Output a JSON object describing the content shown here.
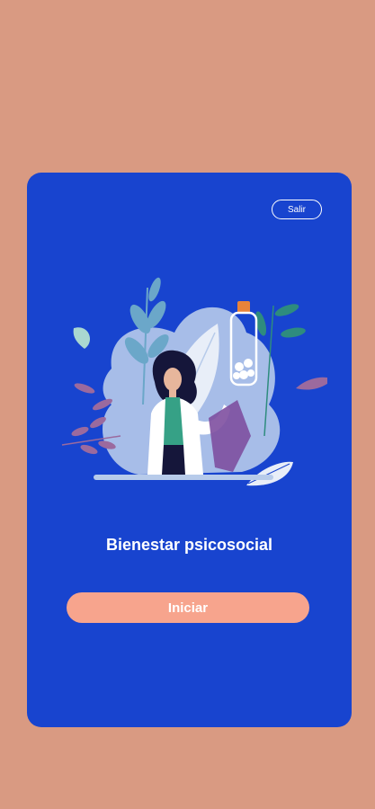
{
  "header": {
    "exit_label": "Salir"
  },
  "main": {
    "title": "Bienestar psicosocial",
    "start_label": "Iniciar"
  },
  "colors": {
    "background": "#D99A82",
    "card": "#1844CF",
    "button": "#F7A48D"
  },
  "illustration": {
    "icon": "doctor-with-medicine-bottle-illustration"
  }
}
